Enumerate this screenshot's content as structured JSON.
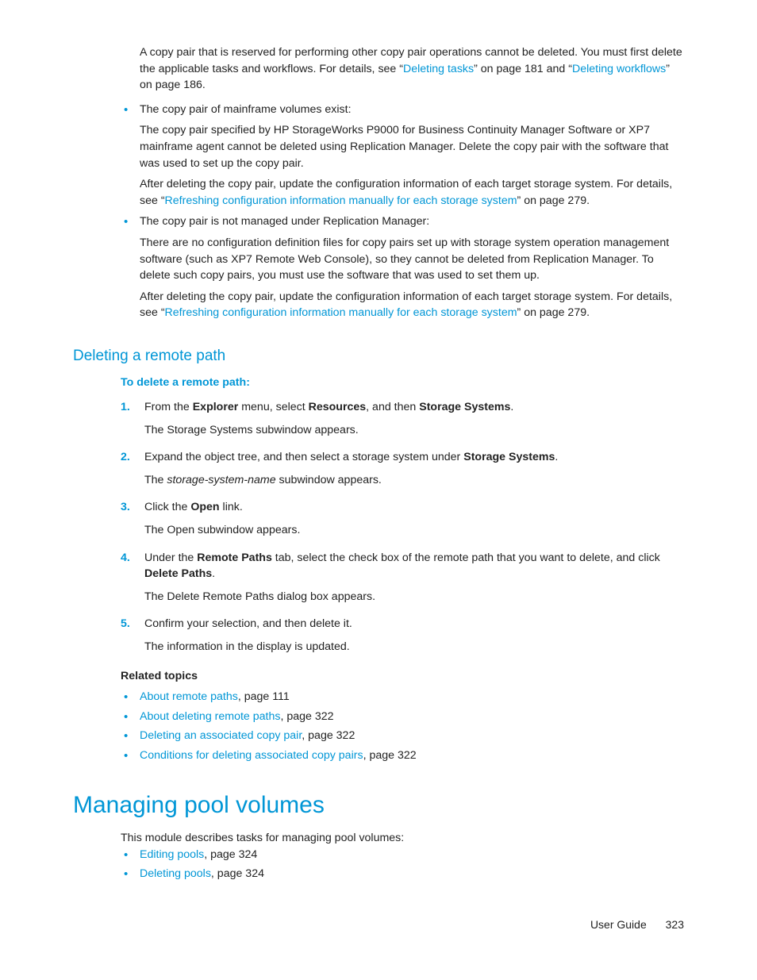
{
  "intro": {
    "p1": "A copy pair that is reserved for performing other copy pair operations cannot be deleted. You must first delete the applicable tasks and workflows. For details, see “",
    "link1": "Deleting tasks",
    "p1b": "” on page 181 and “",
    "link2": "Deleting workflows",
    "p1c": "” on page 186."
  },
  "bullets": [
    {
      "head": "The copy pair of mainframe volumes exist:",
      "body1": "The copy pair specified by HP StorageWorks P9000 for Business Continuity Manager Software or XP7 mainframe agent cannot be deleted using Replication Manager. Delete the copy pair with the software that was used to set up the copy pair.",
      "body2a": "After deleting the copy pair, update the configuration information of each target storage system. For details, see “",
      "body2link": "Refreshing configuration information manually for each storage system",
      "body2b": "” on page 279."
    },
    {
      "head": "The copy pair is not managed under Replication Manager:",
      "body1": "There are no configuration definition files for copy pairs set up with storage system operation management software (such as XP7 Remote Web Console), so they cannot be deleted from Replication Manager. To delete such copy pairs, you must use the software that was used to set them up.",
      "body2a": "After deleting the copy pair, update the configuration information of each target storage system. For details, see “",
      "body2link": "Refreshing configuration information manually for each storage system",
      "body2b": "” on page 279."
    }
  ],
  "section_remote": {
    "heading": "Deleting a remote path",
    "proc_title": "To delete a remote path:",
    "steps": [
      {
        "pre": "From the ",
        "b1": "Explorer",
        "mid1": " menu, select ",
        "b2": "Resources",
        "mid2": ", and then ",
        "b3": "Storage Systems",
        "post": ".",
        "body": "The Storage Systems subwindow appears."
      },
      {
        "pre": "Expand the object tree, and then select a storage system under ",
        "b1": "Storage Systems",
        "post": ".",
        "body_pre": "The ",
        "body_i": "storage-system-name",
        "body_post": " subwindow appears."
      },
      {
        "pre": "Click the ",
        "b1": "Open",
        "post": " link.",
        "body": "The Open subwindow appears."
      },
      {
        "pre": "Under the ",
        "b1": "Remote Paths",
        "mid1": " tab, select the check box of the remote path that you want to delete, and click ",
        "b2": "Delete Paths",
        "post": ".",
        "body": "The Delete Remote Paths dialog box appears."
      },
      {
        "pre": "Confirm your selection, and then delete it.",
        "body": "The information in the display is updated."
      }
    ],
    "related_title": "Related topics",
    "related": [
      {
        "link": "About remote paths",
        "tail": ", page 111"
      },
      {
        "link": "About deleting remote paths",
        "tail": ", page 322"
      },
      {
        "link": "Deleting an associated copy pair",
        "tail": ", page 322"
      },
      {
        "link": "Conditions for deleting associated copy pairs",
        "tail": ", page 322"
      }
    ]
  },
  "section_pool": {
    "heading": "Managing pool volumes",
    "intro": "This module describes tasks for managing pool volumes:",
    "items": [
      {
        "link": "Editing pools",
        "tail": ", page 324"
      },
      {
        "link": "Deleting pools",
        "tail": ", page 324"
      }
    ]
  },
  "footer": {
    "label": "User Guide",
    "page": "323"
  }
}
